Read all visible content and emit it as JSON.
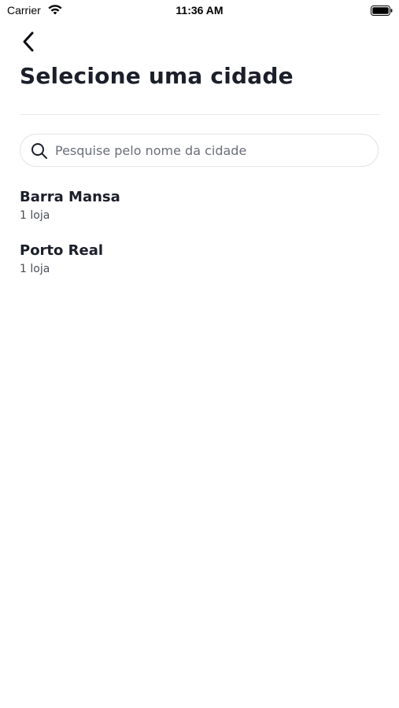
{
  "status_bar": {
    "carrier": "Carrier",
    "time": "11:36 AM",
    "icons": [
      "wifi-icon",
      "battery-icon"
    ]
  },
  "header": {
    "back_icon": "chevron-left-icon",
    "title": "Selecione uma cidade"
  },
  "search": {
    "icon": "search-icon",
    "placeholder": "Pesquise pelo nome da cidade",
    "value": ""
  },
  "cities": [
    {
      "name": "Barra Mansa",
      "count": "1 loja"
    },
    {
      "name": "Porto Real",
      "count": "1 loja"
    }
  ],
  "colors": {
    "text_primary": "#1b1f2a",
    "text_secondary": "#4b4f58",
    "placeholder": "#6b6f78",
    "border": "#e2e3e6"
  }
}
